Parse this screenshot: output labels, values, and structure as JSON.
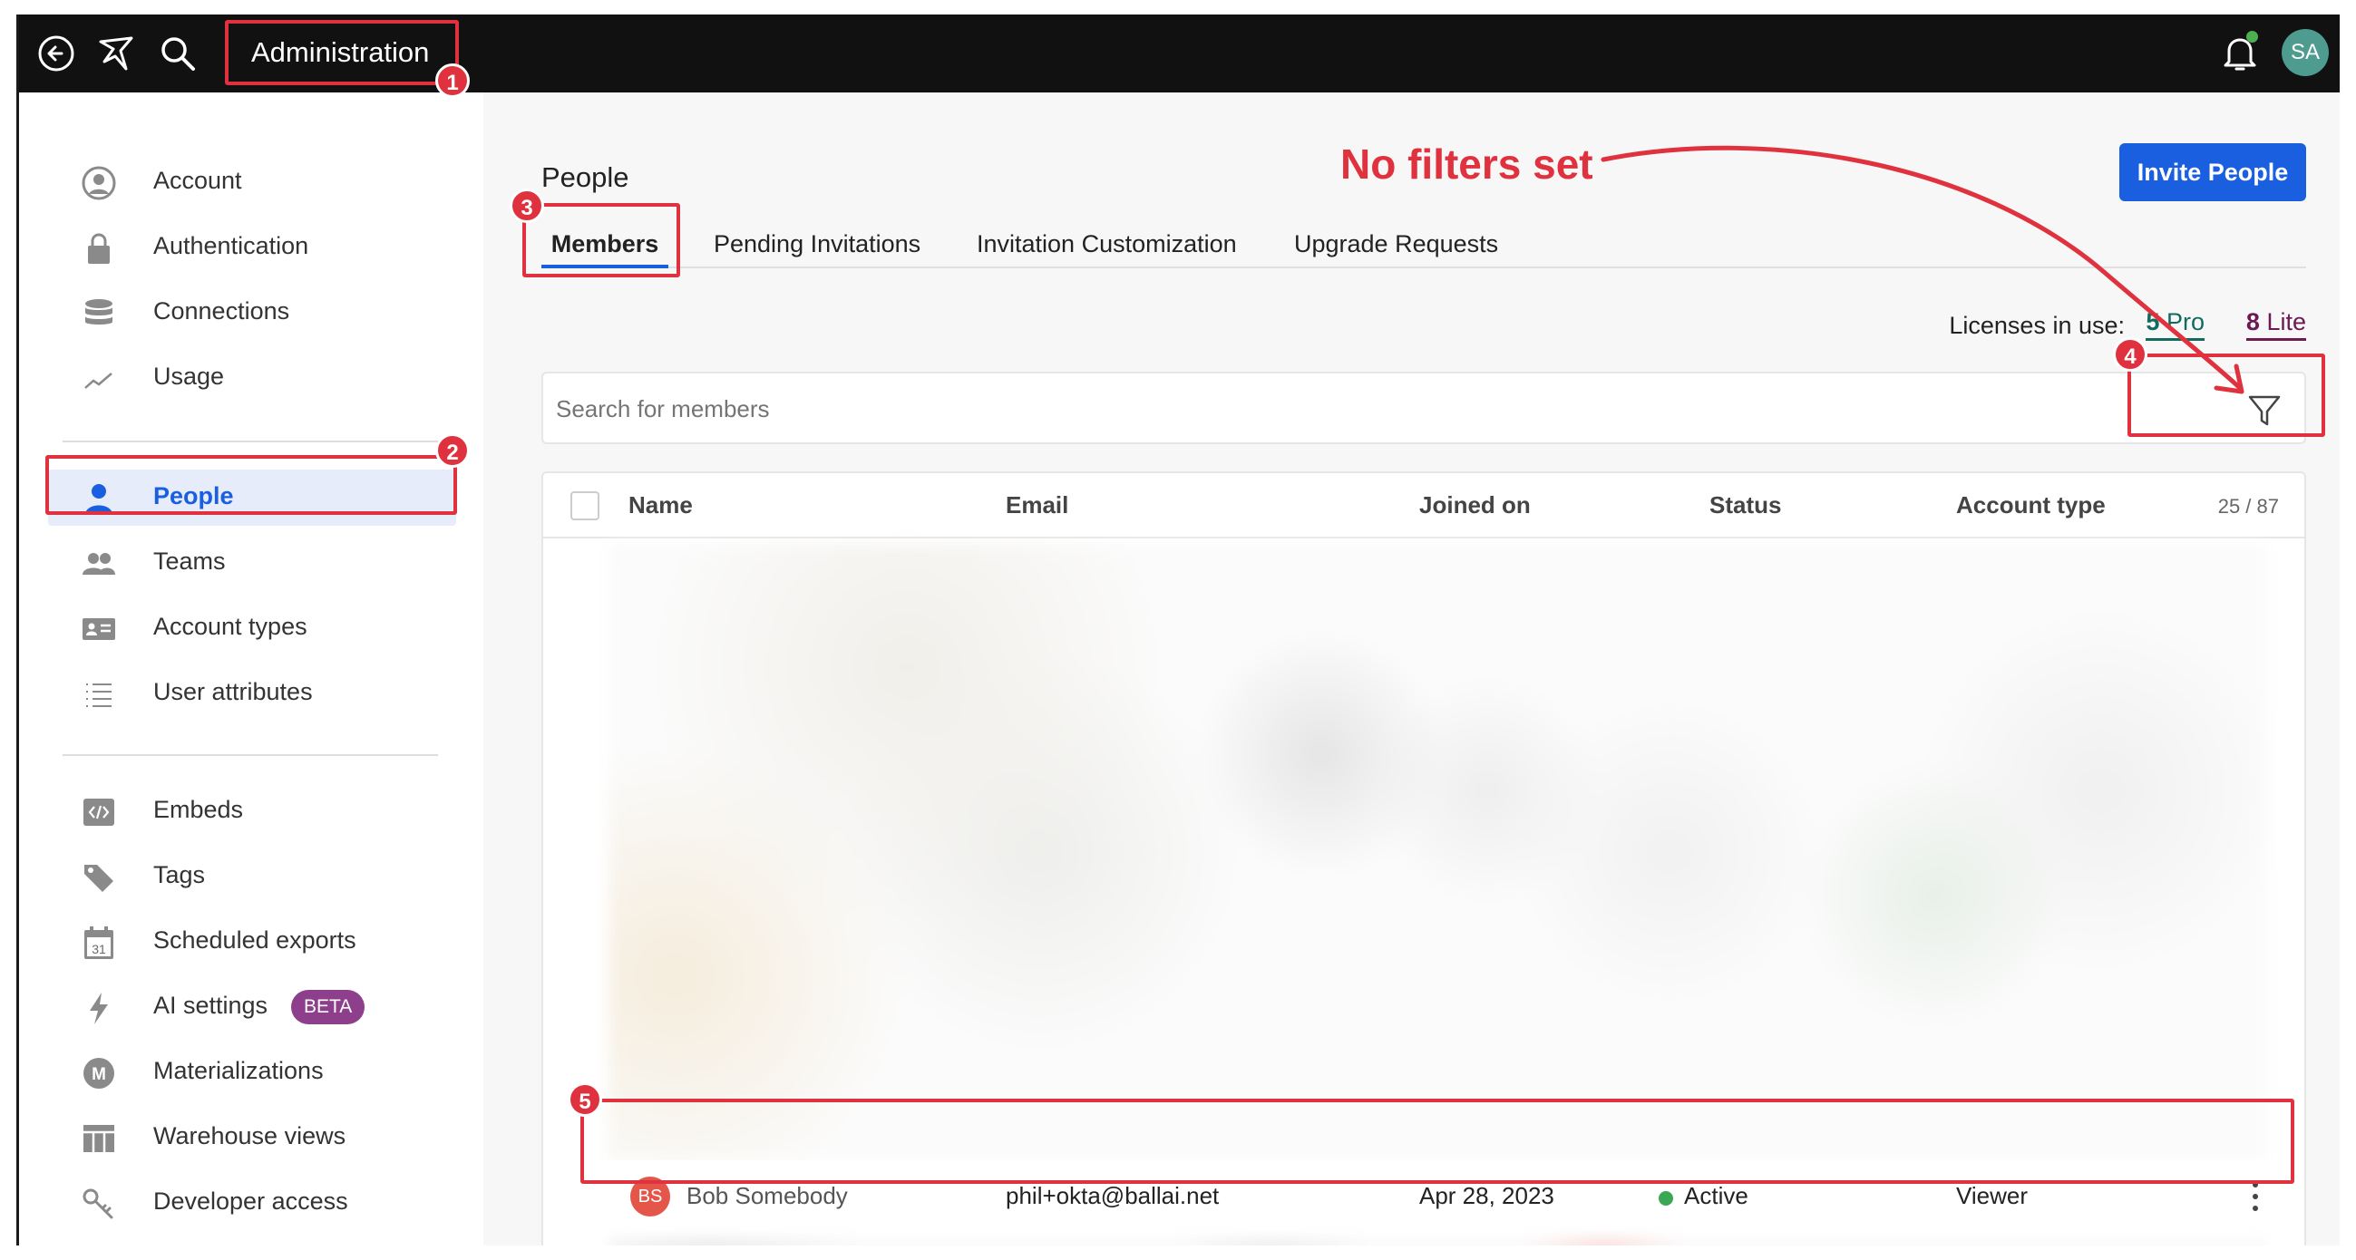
{
  "topbar": {
    "title": "Administration",
    "avatar_initials": "SA",
    "notification_dot_color": "#4caf50"
  },
  "sidebar": {
    "groups": [
      [
        {
          "label": "Account",
          "icon": "account-circle-icon"
        },
        {
          "label": "Authentication",
          "icon": "lock-icon"
        },
        {
          "label": "Connections",
          "icon": "database-icon"
        },
        {
          "label": "Usage",
          "icon": "line-chart-icon"
        }
      ],
      [
        {
          "label": "People",
          "icon": "person-icon",
          "active": true
        },
        {
          "label": "Teams",
          "icon": "people-icon"
        },
        {
          "label": "Account types",
          "icon": "id-card-icon"
        },
        {
          "label": "User attributes",
          "icon": "list-icon"
        }
      ],
      [
        {
          "label": "Embeds",
          "icon": "code-icon"
        },
        {
          "label": "Tags",
          "icon": "tag-icon"
        },
        {
          "label": "Scheduled exports",
          "icon": "calendar-icon",
          "icon_text": "31"
        },
        {
          "label": "AI settings",
          "icon": "lightning-icon",
          "badge": "BETA"
        },
        {
          "label": "Materializations",
          "icon": "m-circle-icon",
          "icon_text": "M"
        },
        {
          "label": "Warehouse views",
          "icon": "table-icon"
        },
        {
          "label": "Developer access",
          "icon": "key-icon"
        }
      ]
    ]
  },
  "main": {
    "page_title": "People",
    "invite_button": "Invite People",
    "tabs": [
      "Members",
      "Pending Invitations",
      "Invitation Customization",
      "Upgrade Requests"
    ],
    "active_tab": "Members",
    "licenses": {
      "label": "Licenses in use:",
      "pro_count": "5",
      "pro_label": "Pro",
      "lite_count": "8",
      "lite_label": "Lite"
    },
    "search": {
      "placeholder": "Search for members",
      "value": ""
    },
    "table": {
      "columns": [
        "Name",
        "Email",
        "Joined on",
        "Status",
        "Account type"
      ],
      "count": "25 / 87",
      "visible_row": {
        "initials": "BS",
        "name": "Bob Somebody",
        "email": "phil+okta@ballai.net",
        "joined": "Apr 28, 2023",
        "status": "Active",
        "status_color": "#3aa853",
        "account_type": "Viewer"
      }
    }
  },
  "annotations": {
    "note": "No filters set",
    "color": "#e0323e",
    "badges": [
      "1",
      "2",
      "3",
      "4",
      "5"
    ]
  }
}
